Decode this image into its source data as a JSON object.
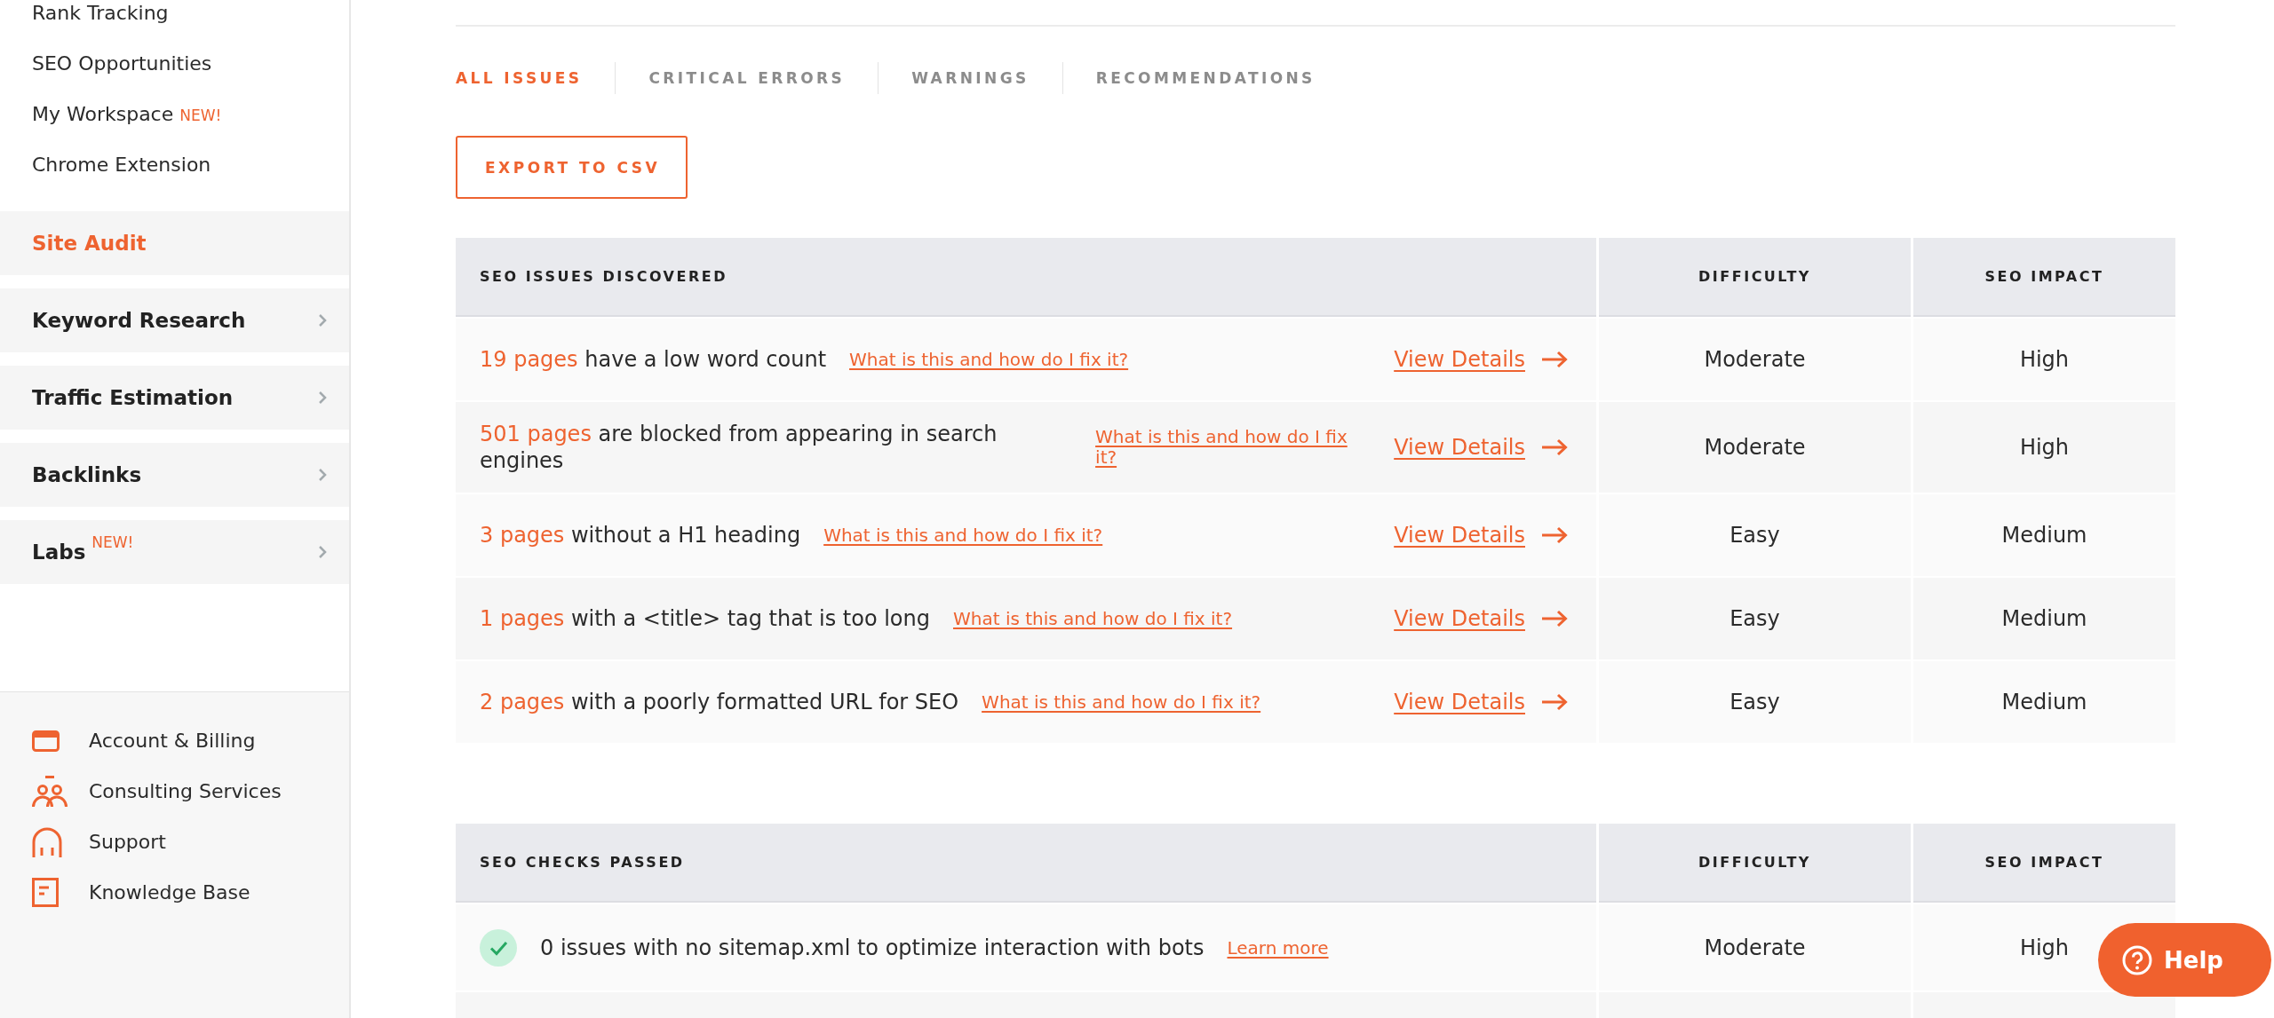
{
  "sidebar": {
    "links": [
      {
        "label": "Rank Tracking",
        "selected": false
      },
      {
        "label": "SEO Opportunities",
        "selected": false
      },
      {
        "label": "My Workspace",
        "badge": "NEW!",
        "selected": false
      },
      {
        "label": "Chrome Extension",
        "selected": false
      }
    ],
    "sections": [
      {
        "label": "Site Audit",
        "selected": true,
        "expandable": false
      },
      {
        "label": "Keyword Research",
        "selected": false,
        "expandable": true
      },
      {
        "label": "Traffic Estimation",
        "selected": false,
        "expandable": true
      },
      {
        "label": "Backlinks",
        "selected": false,
        "expandable": true
      },
      {
        "label": "Labs",
        "badge": "NEW!",
        "selected": false,
        "expandable": true
      }
    ],
    "footer_links": [
      {
        "label": "Account & Billing"
      },
      {
        "label": "Consulting Services"
      },
      {
        "label": "Support"
      },
      {
        "label": "Knowledge Base"
      }
    ]
  },
  "tabs": [
    {
      "label": "ALL ISSUES",
      "selected": true
    },
    {
      "label": "CRITICAL ERRORS",
      "selected": false
    },
    {
      "label": "WARNINGS",
      "selected": false
    },
    {
      "label": "RECOMMENDATIONS",
      "selected": false
    }
  ],
  "export_button": {
    "label": "EXPORT TO CSV"
  },
  "issues_table": {
    "columns": [
      "SEO ISSUES DISCOVERED",
      "DIFFICULTY",
      "SEO IMPACT"
    ],
    "rows": [
      {
        "count": "19 pages",
        "description": "have a low word count",
        "help_link": "What is this and how do I fix it?",
        "details_link": "View Details",
        "difficulty": "Moderate",
        "impact": "High"
      },
      {
        "count": "501 pages",
        "description": "are blocked from appearing in search engines",
        "help_link": "What is this and how do I fix it?",
        "details_link": "View Details",
        "difficulty": "Moderate",
        "impact": "High"
      },
      {
        "count": "3 pages",
        "description": "without a H1 heading",
        "help_link": "What is this and how do I fix it?",
        "details_link": "View Details",
        "difficulty": "Easy",
        "impact": "Medium"
      },
      {
        "count": "1 pages",
        "description": "with a <title> tag that is too long",
        "help_link": "What is this and how do I fix it?",
        "details_link": "View Details",
        "difficulty": "Easy",
        "impact": "Medium"
      },
      {
        "count": "2 pages",
        "description": "with a poorly formatted URL for SEO",
        "help_link": "What is this and how do I fix it?",
        "details_link": "View Details",
        "difficulty": "Easy",
        "impact": "Medium"
      }
    ]
  },
  "checks_table": {
    "columns": [
      "SEO CHECKS PASSED",
      "DIFFICULTY",
      "SEO IMPACT"
    ],
    "rows": [
      {
        "passed": true,
        "description": "0 issues with no sitemap.xml to optimize interaction with bots",
        "learn_link": "Learn more",
        "difficulty": "Moderate",
        "impact": "High"
      }
    ]
  },
  "help_button": {
    "label": "Help"
  }
}
